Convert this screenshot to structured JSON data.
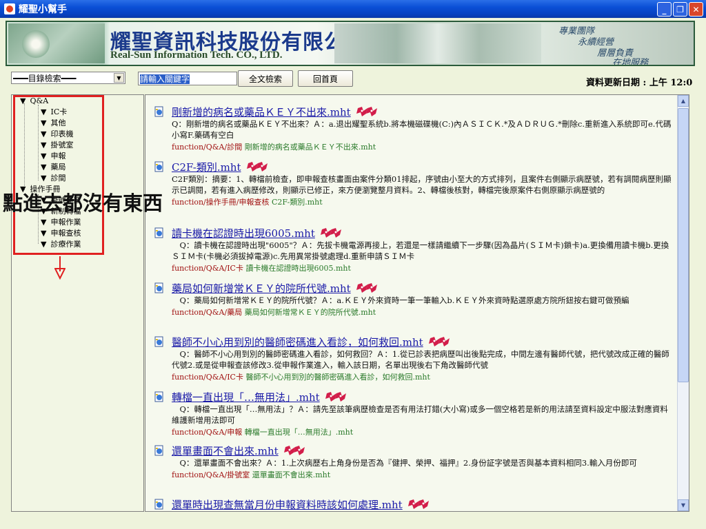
{
  "window": {
    "title": "耀聖小幫手"
  },
  "banner": {
    "company_zh": "耀聖資訊科技股份有限公司",
    "company_en": "Real-Sun Information Tech. CO., LTD.",
    "slogan": [
      "專業團隊",
      "永續經營",
      "層層負責",
      "在地服務"
    ]
  },
  "toolbar": {
    "dir_select": "━━━目錄檢索━━━",
    "search_placeholder": "請輸入關鍵字",
    "fulltext_button": "全文檢索",
    "home_button": "回首頁",
    "update_date": "資料更新日期 : 上午 12:0"
  },
  "tree": {
    "qa": "Q&A",
    "qa_items": [
      "IC卡",
      "其他",
      "印表機",
      "掛號室",
      "申報",
      "藥局",
      "診間"
    ],
    "manual": "操作手冊",
    "manual_items": [
      "掛號作業",
      "新制轉檔",
      "申報作業",
      "申報查核",
      "診療作業"
    ]
  },
  "note": "點進去都沒有東西",
  "results": [
    {
      "title": "剛新增的病名或藥品ＫＥＹ不出來.mht",
      "snippet": "Q：剛新增的病名或藥品ＫＥＹ不出來？Ａ：a.退出耀聖系統b.將本機磁碟機(C:)內ＡＳＩＣＫ.*及ＡＤＲＵＧ.*刪除c.重新進入系統即可e.代碼小寫F.藥碼有空白",
      "path": "function/Q&A/診間",
      "fname": "剛新增的病名或藥品ＫＥＹ不出來.mht"
    },
    {
      "title": "C2F-類別.mht",
      "snippet": "C2F類別：摘要：1、轉檔前檢查，即申報查核畫面由案件分類01排起，序號由小至大的方式排列，且案件右側顯示病歷號，若有調閱病歷則顯示已調閱，若有進入病歷修改，則顯示已修正，來方便瀏覽整月資料。2、轉檔後核對，轉檔完後原案件右側原顯示病歷號的",
      "path": "function/操作手冊/申報查核",
      "fname": "C2F-類別.mht"
    },
    {
      "title": "讀卡機在認證時出現6005.mht",
      "snippet": "　Q：讀卡機在認證時出現\"6005\"？Ａ：先拔卡機電源再接上，若還是一樣請繼續下一步驟(因為晶片(ＳＩＭ卡)鎖卡)a.更換備用讀卡機b.更換ＳＩＭ卡(卡機必須拔掉電源)c.先用異常掛號處理d.重新申請ＳＩＭ卡",
      "path": "function/Q&A/IC卡",
      "fname": "讀卡機在認證時出現6005.mht"
    },
    {
      "title": "藥局如何新增常ＫＥＹ的院所代號.mht",
      "snippet": "　Q：藥局如何新增常ＫＥＹ的院所代號？Ａ：a.ＫＥＹ外來資時一筆一筆輸入b.ＫＥＹ外來資時點選原處方院所鈕按右鍵可做預編",
      "path": "function/Q&A/藥局",
      "fname": "藥局如何新增常ＫＥＹ的院所代號.mht"
    },
    {
      "title": "醫師不小心用到別的醫師密碼進入看診，如何救回.mht",
      "snippet": "　Q：醫師不小心用到別的醫師密碼進入看診，如何救回？Ａ：1.從已診表把病歷叫出後點完成，中間左邊有醫師代號，把代號改成正確的醫師代號2.或是從申報查該修改3.從申報作業進入，輸入該日期，名單出現後右下角改醫師代號",
      "path": "function/Q&A/IC卡",
      "fname": "醫師不小心用到別的醫師密碼進入看診，如何救回.mht"
    },
    {
      "title": "轉檔一直出現「…無用法」.mht",
      "snippet": "　Q：轉檔一直出現「…無用法」？Ａ：請先至該筆病歷檢查是否有用法打錯(大小寫)或多一個空格若是新的用法請至資料設定中服法對應資料維護新增用法即可",
      "path": "function/Q&A/申報",
      "fname": "轉檔一直出現「…無用法」.mht"
    },
    {
      "title": "還單畫面不會出來.mht",
      "snippet": "　Q：還單畫面不會出來？Ａ：1.上次病歷右上角身份是否為『健押、榮押、福押』2.身份証字號是否與基本資料相同3.輸入月份即可",
      "path": "function/Q&A/掛號室",
      "fname": "還單畫面不會出來.mht"
    },
    {
      "title": "還單時出現查無當月份申報資料時該如何處理.mht",
      "snippet": "",
      "path": "",
      "fname": ""
    }
  ]
}
